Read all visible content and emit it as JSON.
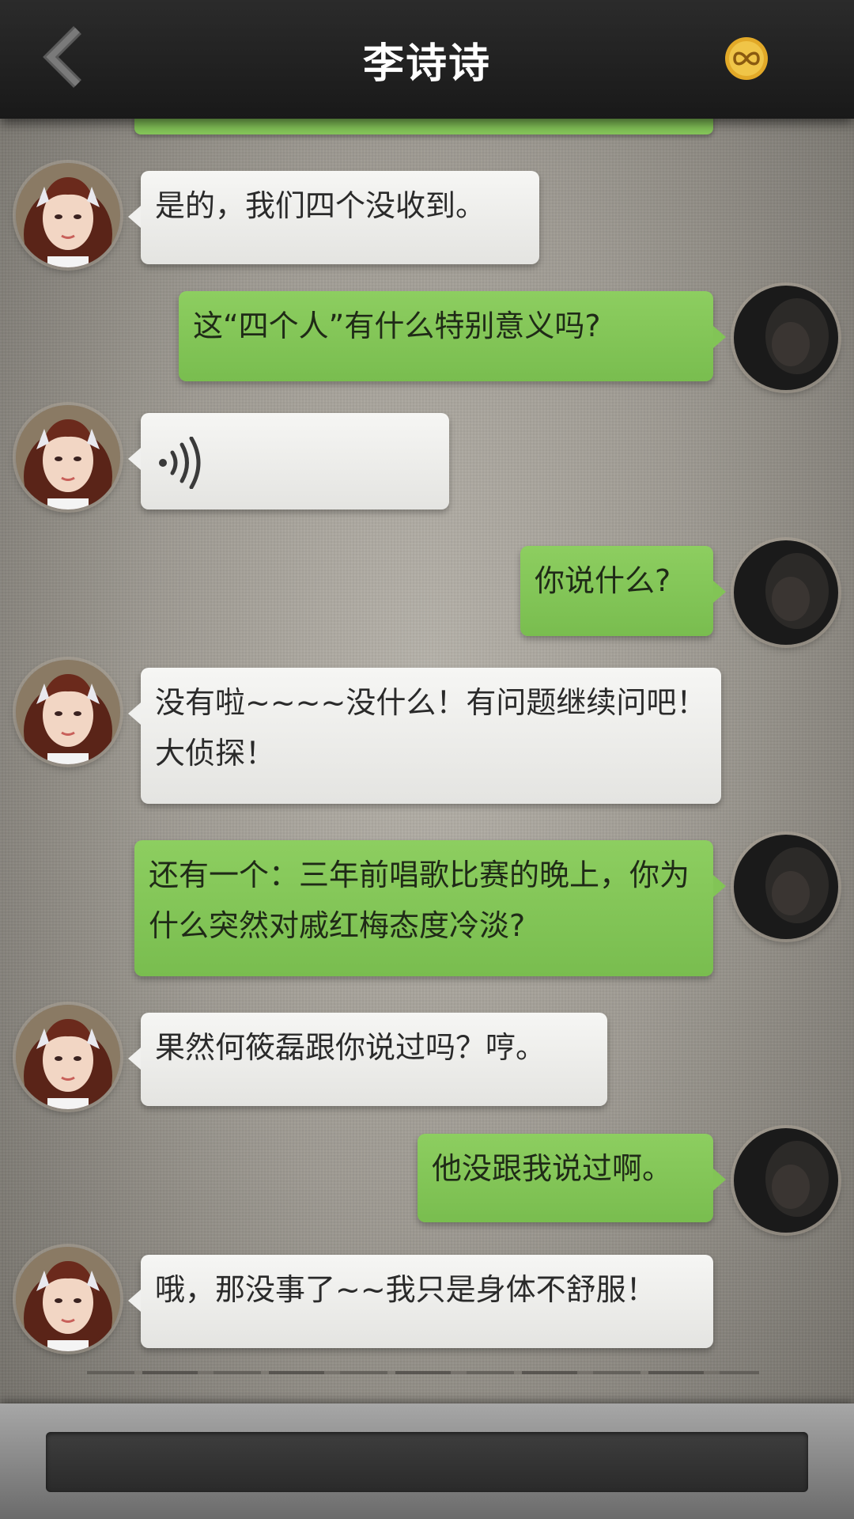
{
  "header": {
    "title": "李诗诗",
    "back_icon": "chevron-left-icon",
    "coin_icon": "infinity-coin-icon",
    "coin_color": "#e2a928"
  },
  "messages": [
    {
      "side": "left",
      "type": "text",
      "text": "是的，我们四个没收到。"
    },
    {
      "side": "right",
      "type": "text",
      "text": "这“四个人”有什么特别意义吗?"
    },
    {
      "side": "left",
      "type": "voice",
      "icon": "voice-icon"
    },
    {
      "side": "right",
      "type": "text",
      "text": "你说什么?"
    },
    {
      "side": "left",
      "type": "text",
      "text": "没有啦~~~~没什么！有问题继续问吧！大侦探！"
    },
    {
      "side": "right",
      "type": "text",
      "text": "还有一个：三年前唱歌比赛的晚上，你为什么突然对戚红梅态度冷淡?"
    },
    {
      "side": "left",
      "type": "text",
      "text": "果然何筱磊跟你说过吗？哼。"
    },
    {
      "side": "right",
      "type": "text",
      "text": "他没跟我说过啊。"
    },
    {
      "side": "left",
      "type": "text",
      "text": "哦，那没事了~~我只是身体不舒服！"
    }
  ],
  "input": {
    "value": "",
    "placeholder": ""
  },
  "colors": {
    "outgoing_bubble": "#82c456",
    "incoming_bubble": "#eeeeec",
    "header_bg": "#202020"
  }
}
